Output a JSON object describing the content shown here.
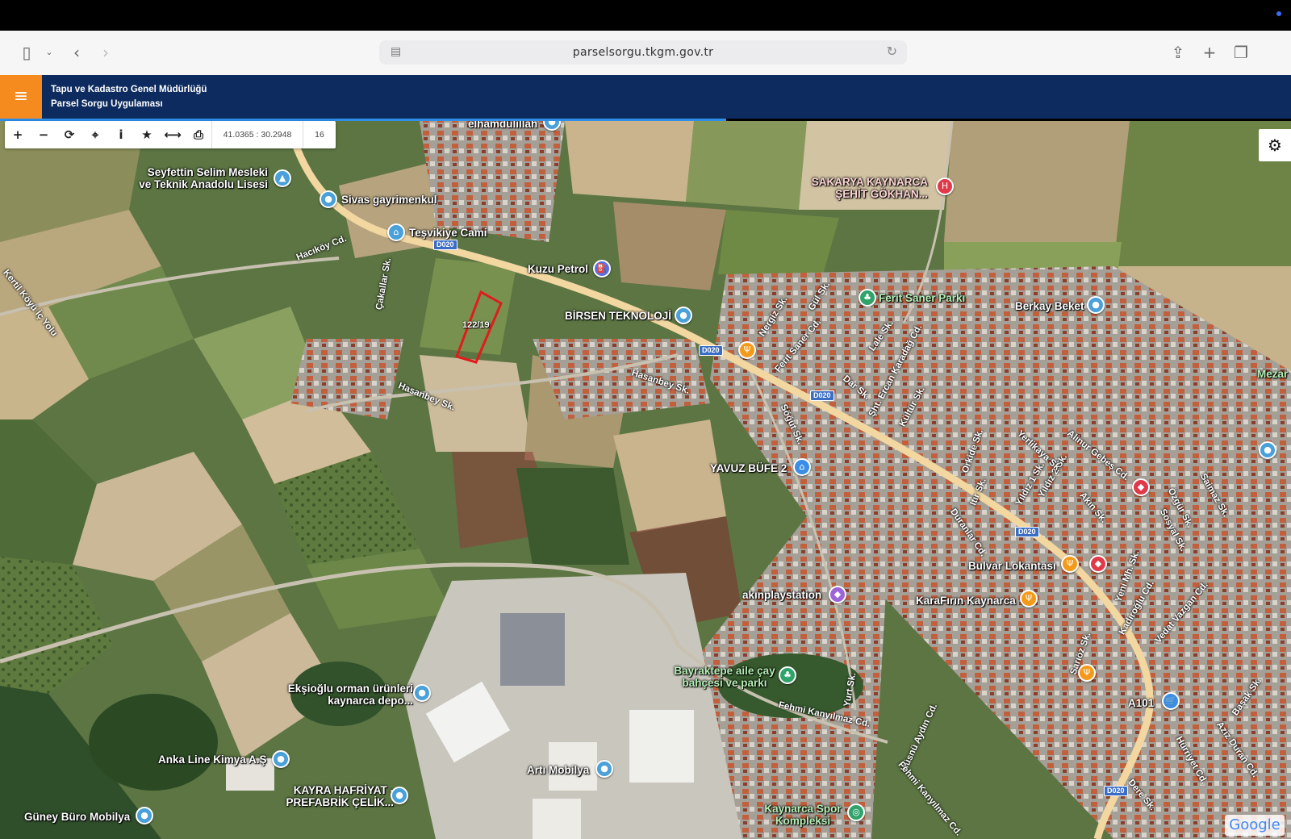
{
  "browser": {
    "url": "parselsorgu.tkgm.gov.tr"
  },
  "app": {
    "title_line1": "Tapu ve Kadastro Genel Müdürlüğü",
    "title_line2": "Parsel Sorgu Uygulaması",
    "menu_icon": "≡"
  },
  "toolbar": {
    "zoom_in": "+",
    "zoom_out": "−",
    "refresh": "⟳",
    "locate": "⌖",
    "info": "i",
    "favorite": "★",
    "measure": "⟷",
    "print": "⎙",
    "coordinates": "41.0365 : 30.2948",
    "zoom_level": "16"
  },
  "map": {
    "parcel_label": "122/19",
    "attribution": "Google",
    "places": [
      {
        "name": "elhamdülillah",
        "icon": "pin-icon"
      },
      {
        "name": "Seyfettin Selim Mesleki ve Teknik Anadolu Lisesi",
        "icon": "school-icon"
      },
      {
        "name": "Sivas gayrimenkul",
        "icon": "pin-icon"
      },
      {
        "name": "Teşvikiye Cami",
        "icon": "mosque-icon"
      },
      {
        "name": "Kuzu Petrol",
        "icon": "fuel-icon"
      },
      {
        "name": "BİRSEN TEKNOLOJİ",
        "icon": "pin-icon"
      },
      {
        "name": "SAKARYA KAYNARCA ŞEHİT GÖKHAN...",
        "icon": "hospital-icon"
      },
      {
        "name": "Ferit Saner Parkı",
        "icon": "park-icon"
      },
      {
        "name": "Berkay Beket",
        "icon": "pin-icon"
      },
      {
        "name": "Mezar",
        "icon": ""
      },
      {
        "name": "YAVUZ BÜFE 2",
        "icon": "shop-icon"
      },
      {
        "name": "Bulvar Lokantası",
        "icon": "restaurant-icon"
      },
      {
        "name": "akınplaystation",
        "icon": "game-icon"
      },
      {
        "name": "KaraFırın Kaynarca",
        "icon": "restaurant-icon"
      },
      {
        "name": "Bayraktepe aile çay bahçesi ve parkı",
        "icon": "park-icon"
      },
      {
        "name": "Ekşioğlu orman ürünleri kaynarca depo...",
        "icon": "pin-icon"
      },
      {
        "name": "Anka Line Kimya A.Ş",
        "icon": "pin-icon"
      },
      {
        "name": "Artı Mobilya",
        "icon": "pin-icon"
      },
      {
        "name": "KAYRA HAFRİYAT - PREFABRİK ÇELİK...",
        "icon": "pin-icon"
      },
      {
        "name": "Güney Büro Mobilya",
        "icon": "pin-icon"
      },
      {
        "name": "Kaynarca Spor Kompleksi",
        "icon": "sport-icon"
      },
      {
        "name": "A101",
        "icon": "cart-icon"
      }
    ],
    "streets": [
      "Kertil Köyü İç Yolu",
      "Hacıköy Cd.",
      "Çakallar Sk.",
      "Hasanbey Sk.",
      "Hasanbey Sk.",
      "Nergiz Sk.",
      "Gül Sk.",
      "Ferit Saner Cd.",
      "Lale Sk.",
      "Şht. Ercan Karadağ Cd.",
      "Dar Sk.",
      "Kültür Sk.",
      "Söğüt Sk.",
      "Orkide Sk.",
      "Itır Sk.",
      "Yıldız 1 Sk.",
      "Yıldız 2 Sk.",
      "Yerlikaya Sk.",
      "Alinur Gebeş Cd.",
      "Akın Sk.",
      "Duranlar Cd.",
      "Özgür Sk.",
      "Sosyal Sk.",
      "Saimaz Sk.",
      "Yeni Mh. Sk.",
      "Kadıroğlu Cd.",
      "Vedat Vazgan Cd.",
      "Sarıöz Sk.",
      "Yurt Sk.",
      "Fehmi Kanyılmaz Cd.",
      "Hüsnü Aydın Cd.",
      "Fehmi Kanyılmaz Cd.",
      "Başak Sk.",
      "Aziz Duran Cd.",
      "Hürriyet Cd.",
      "Dere Sk."
    ],
    "road_code": "D020"
  }
}
